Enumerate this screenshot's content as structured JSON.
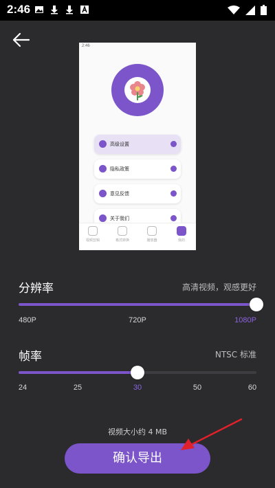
{
  "status_bar": {
    "time": "2:46",
    "icons": [
      "image-icon",
      "download-icon",
      "download-icon",
      "font-icon"
    ],
    "right_icons": [
      "wifi-icon",
      "signal-icon",
      "battery-icon"
    ]
  },
  "preview": {
    "status_time": "2:46",
    "menu_items": [
      "高级设置",
      "隐私政策",
      "意见反馈",
      "关于我们"
    ],
    "tabs": [
      "视频剪辑",
      "格式转换",
      "播放器",
      "我的"
    ],
    "accent": "#7b55c9"
  },
  "resolution": {
    "title": "分辨率",
    "note": "高清视频，观感更好",
    "ticks": [
      "480P",
      "720P",
      "1080P"
    ],
    "selected": "1080P",
    "value_fraction": 1.0
  },
  "framerate": {
    "title": "帧率",
    "note": "NTSC 标准",
    "ticks": [
      "24",
      "25",
      "30",
      "50",
      "60"
    ],
    "selected": "30",
    "value_fraction": 0.5
  },
  "footer": {
    "size_text": "视频大小约 4 MB",
    "confirm_label": "确认导出"
  },
  "colors": {
    "background": "#2b2b2d",
    "accent": "#7b55c9",
    "arrow": "#e0202a"
  }
}
